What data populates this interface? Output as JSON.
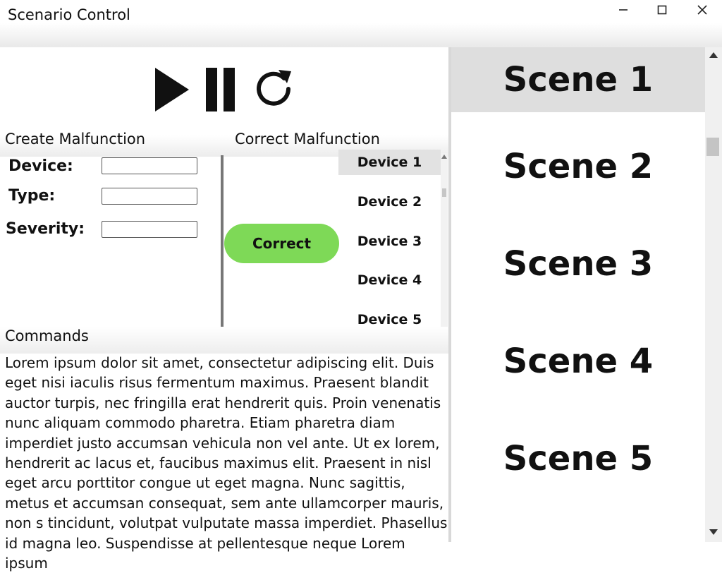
{
  "window": {
    "title": "Scenario Control"
  },
  "controls": {
    "play": "play-icon",
    "pause": "pause-icon",
    "restart": "restart-icon"
  },
  "create_malfunction": {
    "heading": "Create Malfunction",
    "fields": [
      {
        "label": "Device:",
        "value": ""
      },
      {
        "label": "Type:",
        "value": ""
      },
      {
        "label": "Severity:",
        "value": ""
      }
    ]
  },
  "correct_malfunction": {
    "heading": "Correct Malfunction",
    "button_label": "Correct",
    "button_color": "#7ed957",
    "devices": [
      "Device 1",
      "Device 2",
      "Device 3",
      "Device 4",
      "Device 5"
    ],
    "selected_device": "Device 1"
  },
  "commands": {
    "heading": "Commands",
    "text": "Lorem ipsum dolor sit amet, consectetur adipiscing elit. Duis eget nisi iaculis risus fermentum maximus. Praesent blandit auctor turpis, nec fringilla erat hendrerit quis. Proin venenatis nunc aliquam commodo pharetra. Etiam pharetra diam imperdiet justo accumsan vehicula non vel ante. Ut ex lorem, hendrerit ac lacus et, faucibus maximus elit. Praesent in nisl eget arcu porttitor congue ut eget magna. Nunc sagittis, metus et accumsan consequat, sem ante ullamcorper mauris, non s tincidunt, volutpat vulputate massa imperdiet. Phasellus id magna leo. Suspendisse at pellentesque neque Lorem ipsum"
  },
  "scenes": {
    "items": [
      "Scene 1",
      "Scene 2",
      "Scene 3",
      "Scene 4",
      "Scene 5"
    ],
    "selected": "Scene 1"
  }
}
